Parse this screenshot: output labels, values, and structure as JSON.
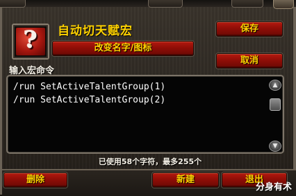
{
  "macro": {
    "name": "自动切天赋宏",
    "lines": [
      "/run SetActiveTalentGroup(1)",
      "/run SetActiveTalentGroup(2)"
    ],
    "char_count_text": "已使用58个字符，最多255个"
  },
  "buttons": {
    "change_name_icon": "改变名字/图标",
    "save": "保存",
    "cancel": "取消",
    "delete": "删除",
    "new": "新建",
    "exit": "退出"
  },
  "labels": {
    "enter_macro": "输入宏命令"
  },
  "icon": {
    "glyph": "?"
  },
  "watermark": "分身有术",
  "colors": {
    "button_red": "#9f1209",
    "gold_text": "#ffd200"
  }
}
